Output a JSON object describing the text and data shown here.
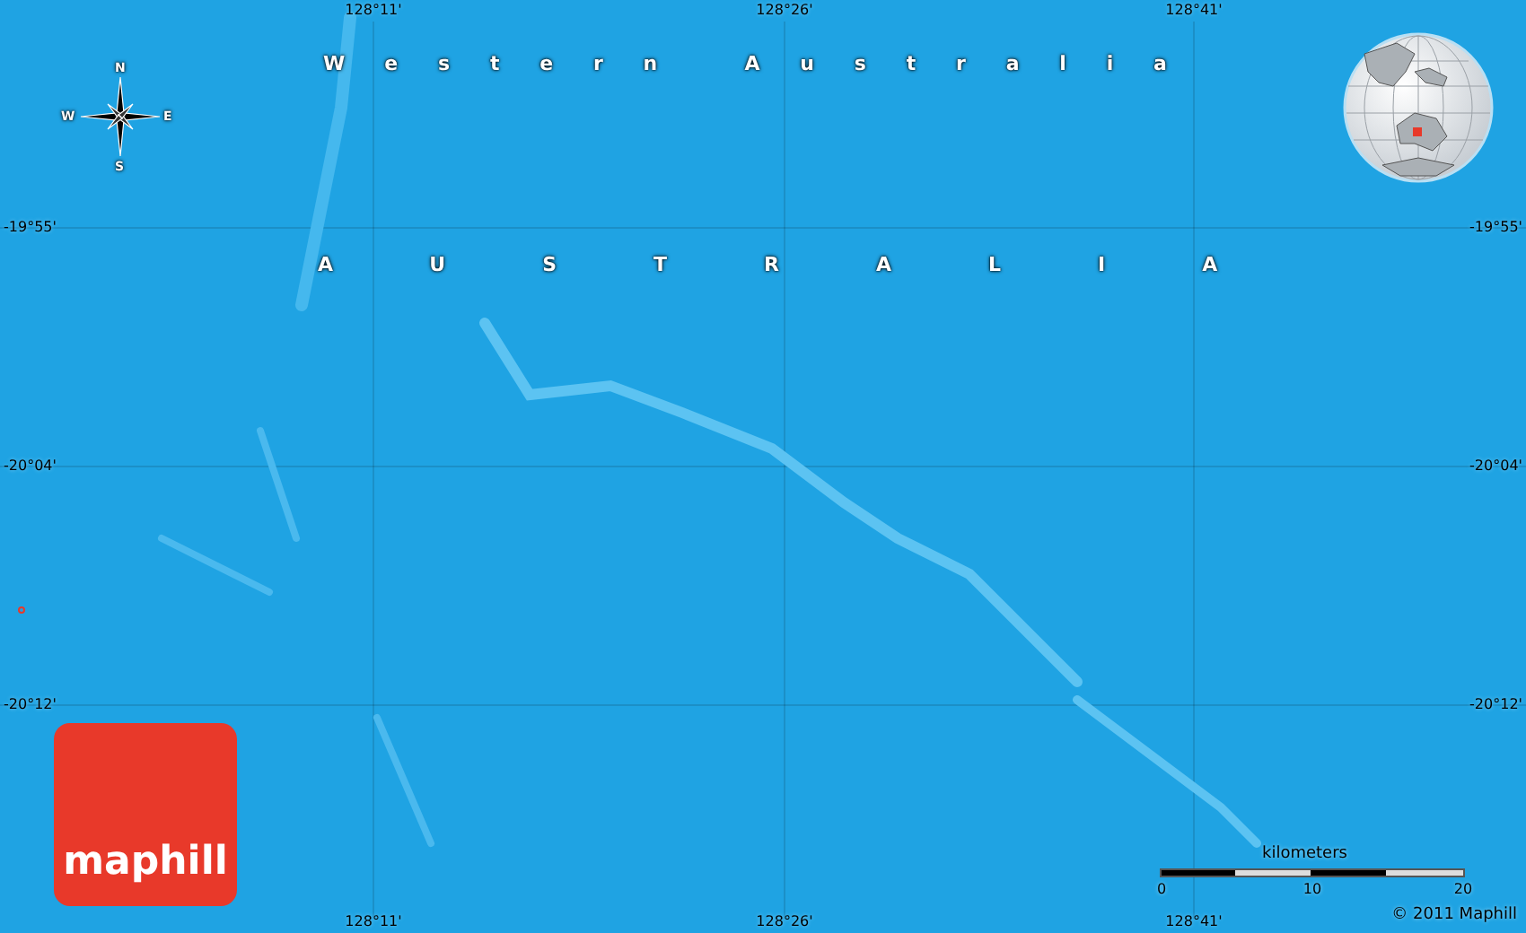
{
  "map": {
    "longitude_labels_top": [
      "128°11'",
      "128°26'",
      "128°41'"
    ],
    "longitude_labels_bottom": [
      "128°11'",
      "128°26'",
      "128°41'"
    ],
    "latitude_labels_left": [
      "-19°55'",
      "-20°04'",
      "-20°12'"
    ],
    "latitude_labels_right": [
      "-19°55'",
      "-20°04'",
      "-20°12'"
    ],
    "region_labels": [
      {
        "text": "Western Australia",
        "kind": "state"
      },
      {
        "text": "AUSTRALIA",
        "kind": "country"
      }
    ],
    "compass": {
      "north": "N",
      "west": "W",
      "east": "E",
      "south": "S"
    },
    "scale_bar": {
      "unit": "kilometers",
      "ticks": [
        "0",
        "10",
        "20"
      ]
    },
    "logo": "maphill",
    "copyright": "© 2011 Maphill"
  }
}
